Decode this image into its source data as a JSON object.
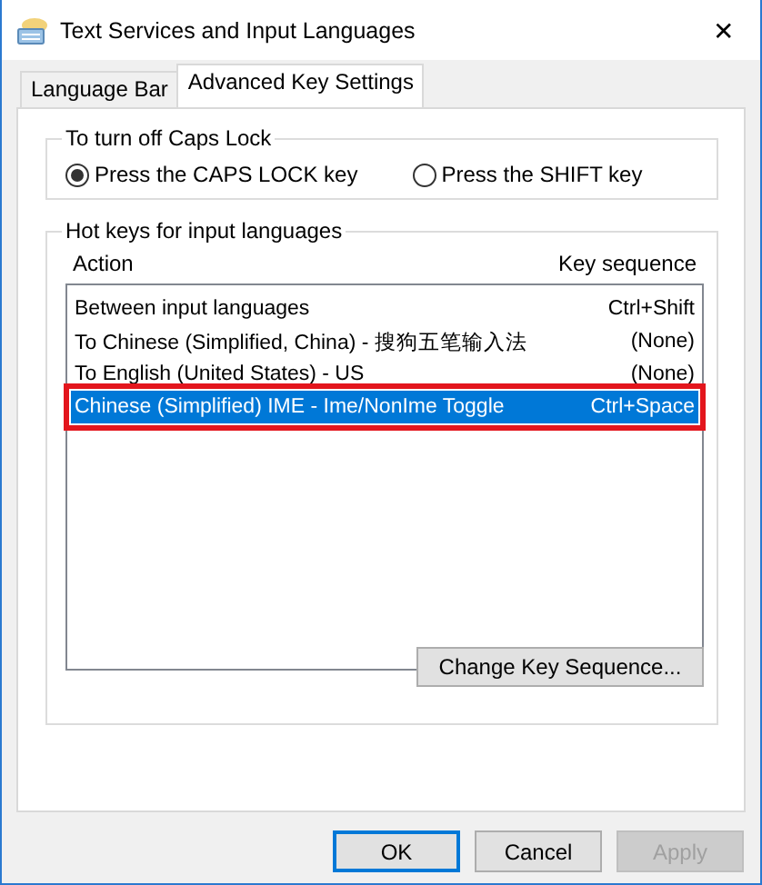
{
  "window": {
    "title": "Text Services and Input Languages",
    "close": "✕"
  },
  "tabs": [
    {
      "label": "Language Bar",
      "selected": false
    },
    {
      "label": "Advanced Key Settings",
      "selected": true
    }
  ],
  "caps_lock": {
    "title": "To turn off Caps Lock",
    "options": [
      {
        "label": "Press the CAPS LOCK key",
        "selected": true
      },
      {
        "label": "Press the SHIFT key",
        "selected": false
      }
    ]
  },
  "hot_keys": {
    "title": "Hot keys for input languages",
    "columns": [
      "Action",
      "Key sequence"
    ],
    "rows": [
      {
        "action": "Between input languages",
        "keys": "Ctrl+Shift",
        "selected": false,
        "highlighted": false
      },
      {
        "action": "To Chinese (Simplified, China) - 搜狗五笔输入法",
        "keys": "(None)",
        "selected": false,
        "highlighted": false
      },
      {
        "action": "To English (United States) - US",
        "keys": "(None)",
        "selected": false,
        "highlighted": false
      },
      {
        "action": "Chinese (Simplified) IME - Ime/NonIme Toggle",
        "keys": "Ctrl+Space",
        "selected": true,
        "highlighted": true
      }
    ],
    "button": "Change Key Sequence..."
  },
  "buttons": [
    {
      "label": "OK",
      "default": true,
      "disabled": false
    },
    {
      "label": "Cancel",
      "default": false,
      "disabled": false
    },
    {
      "label": "Apply",
      "default": false,
      "disabled": true
    }
  ]
}
